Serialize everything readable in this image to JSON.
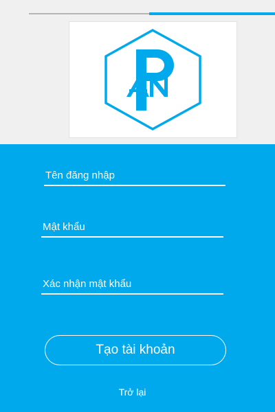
{
  "progress": {
    "value": 0.51,
    "track_color": "#b5b5b5",
    "fill_color": "#00a8ec"
  },
  "logo": {
    "icon": "pn-hexagon-logo",
    "letters": "PN"
  },
  "form": {
    "username": {
      "placeholder": "Tên đăng nhập",
      "value": ""
    },
    "password": {
      "placeholder": "Mật khẩu",
      "value": ""
    },
    "confirm_password": {
      "placeholder": "Xác nhận mật khẩu",
      "value": ""
    },
    "create_account_label": "Tạo tài khoản",
    "back_label": "Trở lại"
  },
  "colors": {
    "accent": "#00a8ec",
    "background": "#f0f0f0",
    "text_on_accent": "#ffffff"
  }
}
